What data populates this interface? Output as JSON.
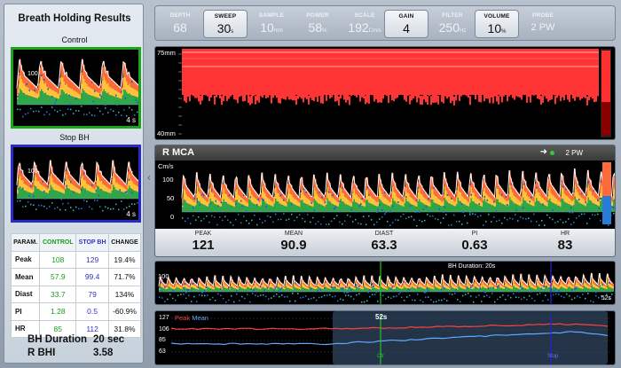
{
  "left_panel": {
    "title": "Breath Holding Results",
    "control_label": "Control",
    "stop_label": "Stop BH",
    "thumb_control": {
      "scale": "100",
      "time": "4 s"
    },
    "thumb_stop": {
      "scale": "100",
      "time": "4 s"
    },
    "table": {
      "headers": [
        "PARAM.",
        "CONTROL",
        "STOP BH",
        "CHANGE"
      ],
      "rows": [
        [
          "Peak",
          "108",
          "129",
          "19.4%"
        ],
        [
          "Mean",
          "57.9",
          "99.4",
          "71.7%"
        ],
        [
          "Diast",
          "33.7",
          "79",
          "134%"
        ],
        [
          "PI",
          "1.28",
          "0.5",
          "-60.9%"
        ],
        [
          "HR",
          "85",
          "112",
          "31.8%"
        ]
      ]
    },
    "bh_duration_label": "BH Duration",
    "bh_duration_value": "20 sec",
    "rbhi_label": "R BHI",
    "rbhi_value": "3.58"
  },
  "toolbar": {
    "depth": {
      "label": "DEPTH",
      "value": "68",
      "unit": ""
    },
    "sweep": {
      "label": "SWEEP",
      "value": "30",
      "unit": "s"
    },
    "sample": {
      "label": "SAMPLE",
      "value": "10",
      "unit": "mm"
    },
    "power": {
      "label": "POWER",
      "value": "58",
      "unit": "%"
    },
    "scale": {
      "label": "SCALE",
      "value": "192",
      "unit": "Cm/s"
    },
    "gain": {
      "label": "GAIN",
      "value": "4",
      "unit": ""
    },
    "filter": {
      "label": "FILTER",
      "value": "250",
      "unit": "Hz"
    },
    "volume": {
      "label": "VOLUME",
      "value": "10",
      "unit": "%"
    },
    "probe": {
      "label": "PROBE",
      "value": "2 PW",
      "unit": ""
    }
  },
  "mmode": {
    "top_label": "75mm",
    "bottom_label": "40mm"
  },
  "mca": {
    "title": "R MCA",
    "probe": "2 PW",
    "probe_icon": "arrow-right-icon",
    "unit": "Cm/s",
    "ticks": [
      "100",
      "50",
      "0"
    ],
    "stats": [
      {
        "label": "PEAK",
        "value": "121"
      },
      {
        "label": "MEAN",
        "value": "90.9"
      },
      {
        "label": "DIAST",
        "value": "63.3"
      },
      {
        "label": "PI",
        "value": "0.63"
      },
      {
        "label": "HR",
        "value": "83"
      }
    ]
  },
  "overview": {
    "scale": "100",
    "bh_text": "BH Duration: 20s",
    "time": "52s"
  },
  "trend": {
    "legend_peak": "Peak",
    "legend_mean": "Mean",
    "time": "52s",
    "y_values": [
      "127",
      "106",
      "85",
      "63"
    ],
    "marker_ctr": "Ctr",
    "marker_stop": "Stop",
    "colors": {
      "peak": "#ff4040",
      "mean": "#60a8ff",
      "ctr_marker": "#22c422",
      "stop_marker": "#2222dd"
    }
  }
}
